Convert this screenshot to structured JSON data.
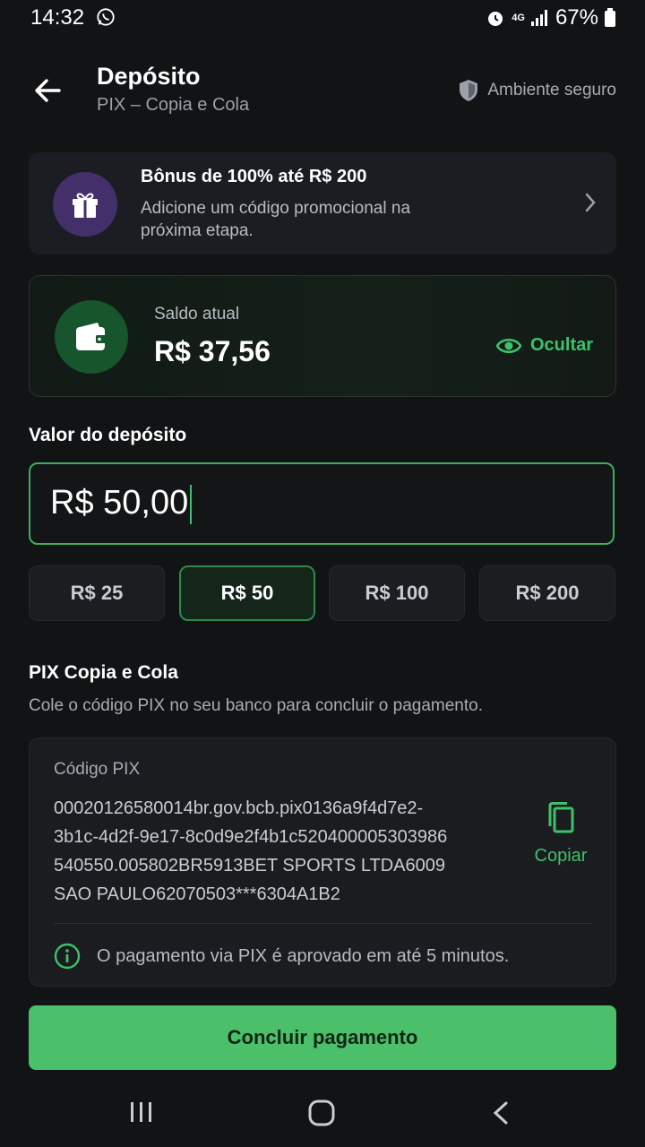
{
  "status_bar": {
    "time": "14:32",
    "network": "4G",
    "battery": "67%"
  },
  "header": {
    "title": "Depósito",
    "subtitle": "PIX – Copia e Cola",
    "secure_label": "Ambiente seguro"
  },
  "bonus": {
    "title": "Bônus de 100% até R$ 200",
    "description_line1": "Adicione um código promocional na",
    "description_line2": "próxima etapa."
  },
  "balance": {
    "label": "Saldo atual",
    "value": "R$ 37,56",
    "hide_label": "Ocultar"
  },
  "deposit": {
    "label": "Valor do depósito",
    "value": "R$ 50,00",
    "presets": [
      "R$ 25",
      "R$ 50",
      "R$ 100",
      "R$ 200"
    ],
    "selected": "R$ 50"
  },
  "pix": {
    "title": "PIX Copia e Cola",
    "description": "Cole o código PIX no seu banco para concluir o pagamento.",
    "code_label": "Código PIX",
    "code_lines": [
      "00020126580014br.gov.bcb.pix0136a9f4d7e2-",
      "3b1c-4d2f-9e17-8c0d9e2f4b1c520400005303986",
      "540550.005802BR5913BET SPORTS LTDA6009",
      "SAO PAULO62070503***6304A1B2"
    ],
    "copy_label": "Copiar",
    "info": "O pagamento via PIX é aprovado em até 5 minutos."
  },
  "primary_button": "Concluir pagamento",
  "colors": {
    "accent": "#3fc16a",
    "button": "#4bbf6a",
    "background": "#111315",
    "bonus_icon_bg": "#43306b"
  },
  "icons": {
    "back": "arrow-left-icon",
    "secure": "shield-icon",
    "bonus": "gift-icon",
    "balance": "wallet-icon",
    "hide": "eye-icon",
    "copy": "copy-icon",
    "info": "info-icon"
  }
}
